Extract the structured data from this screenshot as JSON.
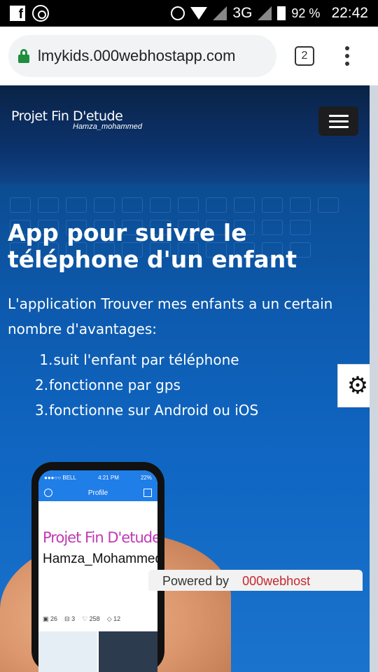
{
  "status_bar": {
    "network": "3G",
    "battery_pct": "92 %",
    "time": "22:42"
  },
  "browser": {
    "url": "lmykids.000webhostapp.com",
    "tab_count": "2"
  },
  "site": {
    "brand_title": "Projet Fin D'etude",
    "brand_subtitle": "Hamza_mohammed",
    "hero_title": "App pour suivre le téléphone d'un enfant",
    "intro": "L'application Trouver mes enfants a un certain nombre d'avantages:",
    "features": [
      {
        "num": "1.",
        "text": "suit l'enfant par téléphone"
      },
      {
        "num": "2.",
        "text": "fonctionne par gps"
      },
      {
        "num": "3.",
        "text": "fonctionne sur Android ou iOS"
      }
    ]
  },
  "phone_mockup": {
    "carrier": "●●●○○ BELL",
    "time": "4:21 PM",
    "battery": "22%",
    "screen_title": "Profile",
    "project_title": "Projet Fin D'etude",
    "author": "Hamza_Mohammed",
    "stats": [
      "26",
      "3",
      "258",
      "12"
    ]
  },
  "footer": {
    "powered_label": "Powered by",
    "powered_brand": "000webhost"
  }
}
